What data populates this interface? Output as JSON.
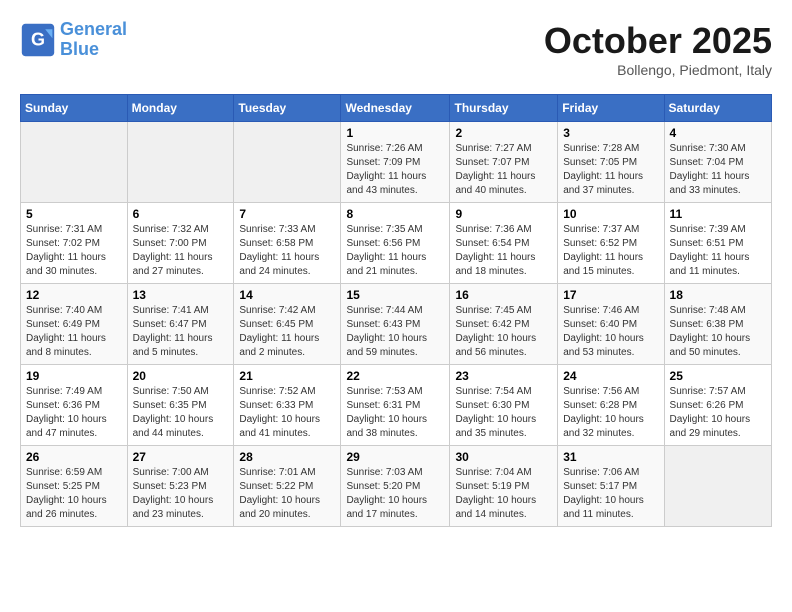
{
  "header": {
    "logo_line1": "General",
    "logo_line2": "Blue",
    "month": "October 2025",
    "location": "Bollengo, Piedmont, Italy"
  },
  "weekdays": [
    "Sunday",
    "Monday",
    "Tuesday",
    "Wednesday",
    "Thursday",
    "Friday",
    "Saturday"
  ],
  "weeks": [
    [
      {
        "day": "",
        "info": ""
      },
      {
        "day": "",
        "info": ""
      },
      {
        "day": "",
        "info": ""
      },
      {
        "day": "1",
        "info": "Sunrise: 7:26 AM\nSunset: 7:09 PM\nDaylight: 11 hours and 43 minutes."
      },
      {
        "day": "2",
        "info": "Sunrise: 7:27 AM\nSunset: 7:07 PM\nDaylight: 11 hours and 40 minutes."
      },
      {
        "day": "3",
        "info": "Sunrise: 7:28 AM\nSunset: 7:05 PM\nDaylight: 11 hours and 37 minutes."
      },
      {
        "day": "4",
        "info": "Sunrise: 7:30 AM\nSunset: 7:04 PM\nDaylight: 11 hours and 33 minutes."
      }
    ],
    [
      {
        "day": "5",
        "info": "Sunrise: 7:31 AM\nSunset: 7:02 PM\nDaylight: 11 hours and 30 minutes."
      },
      {
        "day": "6",
        "info": "Sunrise: 7:32 AM\nSunset: 7:00 PM\nDaylight: 11 hours and 27 minutes."
      },
      {
        "day": "7",
        "info": "Sunrise: 7:33 AM\nSunset: 6:58 PM\nDaylight: 11 hours and 24 minutes."
      },
      {
        "day": "8",
        "info": "Sunrise: 7:35 AM\nSunset: 6:56 PM\nDaylight: 11 hours and 21 minutes."
      },
      {
        "day": "9",
        "info": "Sunrise: 7:36 AM\nSunset: 6:54 PM\nDaylight: 11 hours and 18 minutes."
      },
      {
        "day": "10",
        "info": "Sunrise: 7:37 AM\nSunset: 6:52 PM\nDaylight: 11 hours and 15 minutes."
      },
      {
        "day": "11",
        "info": "Sunrise: 7:39 AM\nSunset: 6:51 PM\nDaylight: 11 hours and 11 minutes."
      }
    ],
    [
      {
        "day": "12",
        "info": "Sunrise: 7:40 AM\nSunset: 6:49 PM\nDaylight: 11 hours and 8 minutes."
      },
      {
        "day": "13",
        "info": "Sunrise: 7:41 AM\nSunset: 6:47 PM\nDaylight: 11 hours and 5 minutes."
      },
      {
        "day": "14",
        "info": "Sunrise: 7:42 AM\nSunset: 6:45 PM\nDaylight: 11 hours and 2 minutes."
      },
      {
        "day": "15",
        "info": "Sunrise: 7:44 AM\nSunset: 6:43 PM\nDaylight: 10 hours and 59 minutes."
      },
      {
        "day": "16",
        "info": "Sunrise: 7:45 AM\nSunset: 6:42 PM\nDaylight: 10 hours and 56 minutes."
      },
      {
        "day": "17",
        "info": "Sunrise: 7:46 AM\nSunset: 6:40 PM\nDaylight: 10 hours and 53 minutes."
      },
      {
        "day": "18",
        "info": "Sunrise: 7:48 AM\nSunset: 6:38 PM\nDaylight: 10 hours and 50 minutes."
      }
    ],
    [
      {
        "day": "19",
        "info": "Sunrise: 7:49 AM\nSunset: 6:36 PM\nDaylight: 10 hours and 47 minutes."
      },
      {
        "day": "20",
        "info": "Sunrise: 7:50 AM\nSunset: 6:35 PM\nDaylight: 10 hours and 44 minutes."
      },
      {
        "day": "21",
        "info": "Sunrise: 7:52 AM\nSunset: 6:33 PM\nDaylight: 10 hours and 41 minutes."
      },
      {
        "day": "22",
        "info": "Sunrise: 7:53 AM\nSunset: 6:31 PM\nDaylight: 10 hours and 38 minutes."
      },
      {
        "day": "23",
        "info": "Sunrise: 7:54 AM\nSunset: 6:30 PM\nDaylight: 10 hours and 35 minutes."
      },
      {
        "day": "24",
        "info": "Sunrise: 7:56 AM\nSunset: 6:28 PM\nDaylight: 10 hours and 32 minutes."
      },
      {
        "day": "25",
        "info": "Sunrise: 7:57 AM\nSunset: 6:26 PM\nDaylight: 10 hours and 29 minutes."
      }
    ],
    [
      {
        "day": "26",
        "info": "Sunrise: 6:59 AM\nSunset: 5:25 PM\nDaylight: 10 hours and 26 minutes."
      },
      {
        "day": "27",
        "info": "Sunrise: 7:00 AM\nSunset: 5:23 PM\nDaylight: 10 hours and 23 minutes."
      },
      {
        "day": "28",
        "info": "Sunrise: 7:01 AM\nSunset: 5:22 PM\nDaylight: 10 hours and 20 minutes."
      },
      {
        "day": "29",
        "info": "Sunrise: 7:03 AM\nSunset: 5:20 PM\nDaylight: 10 hours and 17 minutes."
      },
      {
        "day": "30",
        "info": "Sunrise: 7:04 AM\nSunset: 5:19 PM\nDaylight: 10 hours and 14 minutes."
      },
      {
        "day": "31",
        "info": "Sunrise: 7:06 AM\nSunset: 5:17 PM\nDaylight: 10 hours and 11 minutes."
      },
      {
        "day": "",
        "info": ""
      }
    ]
  ]
}
